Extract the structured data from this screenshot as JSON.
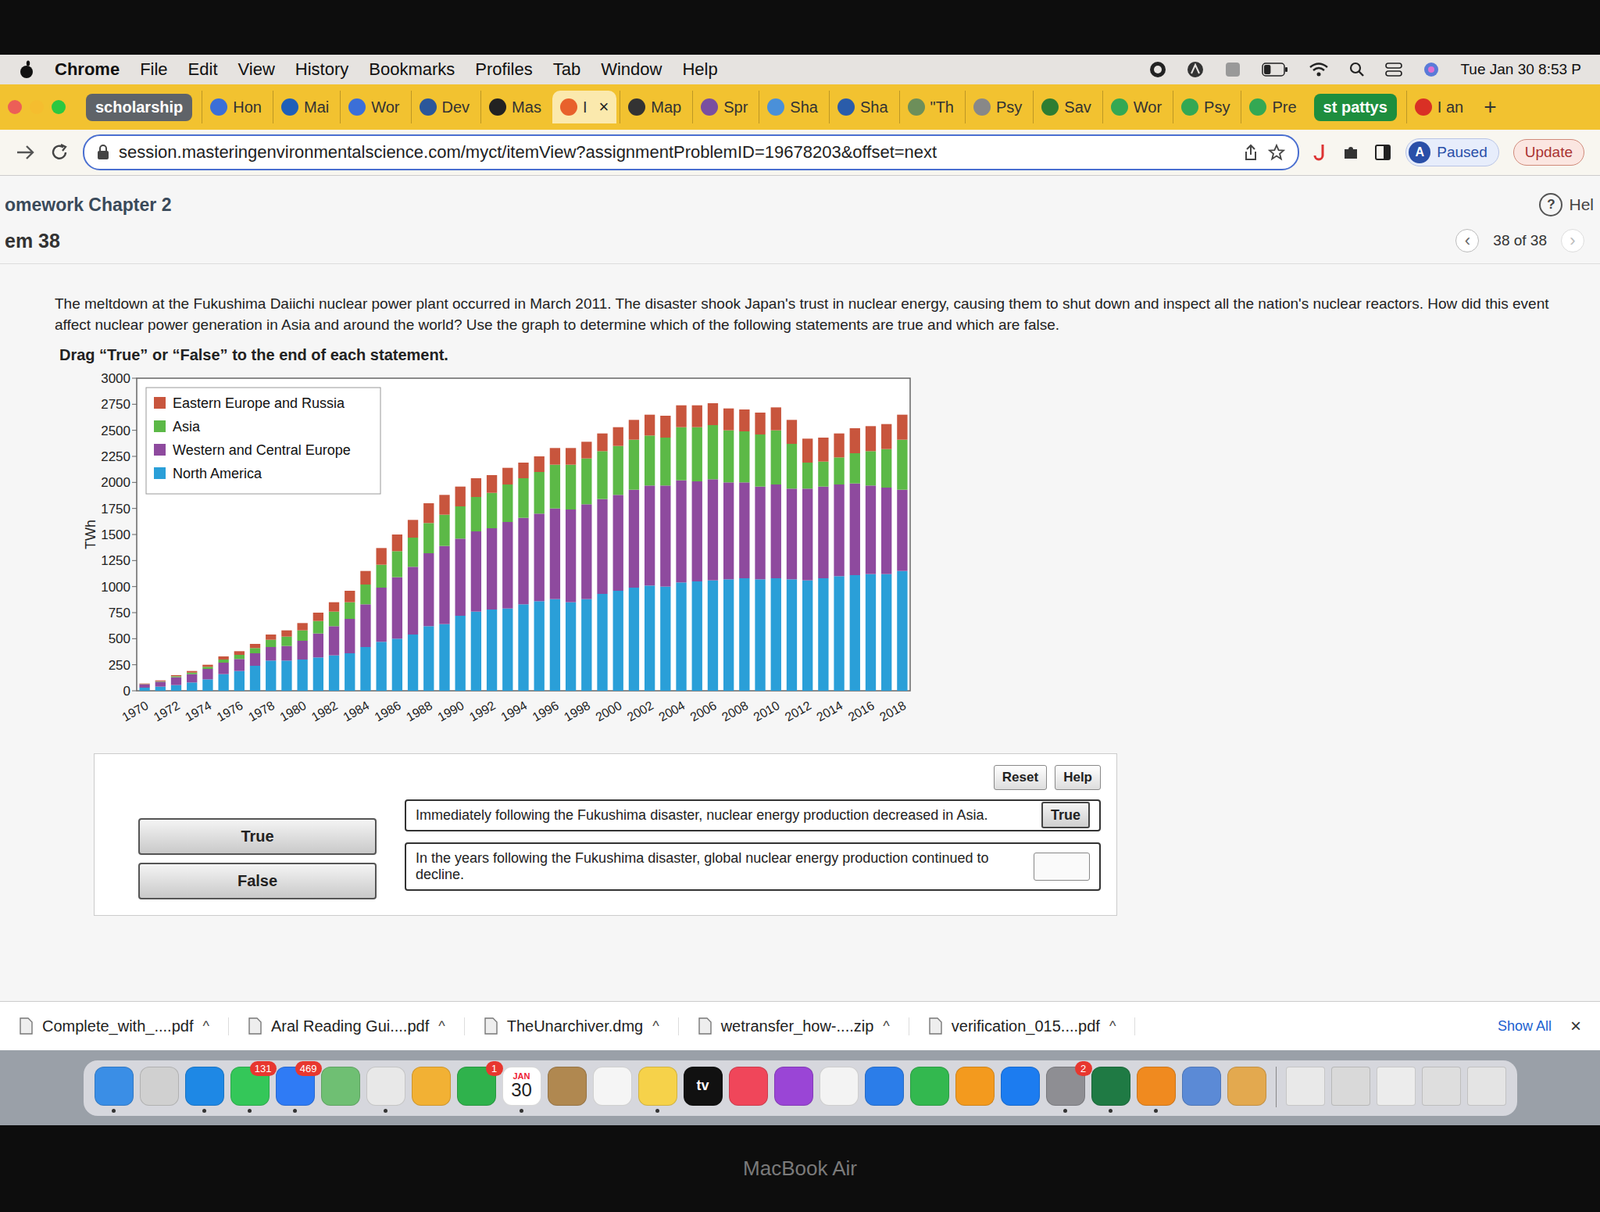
{
  "menubar": {
    "app": "Chrome",
    "items": [
      "File",
      "Edit",
      "View",
      "History",
      "Bookmarks",
      "Profiles",
      "Tab",
      "Window",
      "Help"
    ],
    "battery_level": 0.35,
    "clock": "Tue Jan 30  8:53 P"
  },
  "tabbar": [
    {
      "kind": "group",
      "label": "scholarship",
      "color": "#5f6368"
    },
    {
      "kind": "tab",
      "label": "Hon",
      "selected": false,
      "icon_color": "#3b6fd8"
    },
    {
      "kind": "tab",
      "label": "Mai",
      "selected": false,
      "icon_color": "#1f5fb8"
    },
    {
      "kind": "tab",
      "label": "Wor",
      "selected": false,
      "icon_color": "#3b6fd8"
    },
    {
      "kind": "tab",
      "label": "Dev",
      "selected": false,
      "icon_color": "#2b579a"
    },
    {
      "kind": "tab",
      "label": "Mas",
      "selected": false,
      "icon_color": "#222222"
    },
    {
      "kind": "tab",
      "label": "I",
      "selected": true,
      "icon_color": "#e8612c",
      "close": "×"
    },
    {
      "kind": "tab",
      "label": "Map",
      "selected": false,
      "icon_color": "#333333"
    },
    {
      "kind": "tab",
      "label": "Spr",
      "selected": false,
      "icon_color": "#7a4fa0"
    },
    {
      "kind": "tab",
      "label": "Sha",
      "selected": false,
      "icon_color": "#4a90d9"
    },
    {
      "kind": "tab",
      "label": "Sha",
      "selected": false,
      "icon_color": "#2a5caa"
    },
    {
      "kind": "tab",
      "label": "\"Th",
      "selected": false,
      "icon_color": "#6d8f5a"
    },
    {
      "kind": "tab",
      "label": "Psy",
      "selected": false,
      "icon_color": "#888888"
    },
    {
      "kind": "tab",
      "label": "Sav",
      "selected": false,
      "icon_color": "#2e7d32"
    },
    {
      "kind": "tab",
      "label": "Wor",
      "selected": false,
      "icon_color": "#34a853"
    },
    {
      "kind": "tab",
      "label": "Psy",
      "selected": false,
      "icon_color": "#34a853"
    },
    {
      "kind": "tab",
      "label": "Pre",
      "selected": false,
      "icon_color": "#34a853"
    },
    {
      "kind": "group",
      "label": "st pattys",
      "color": "#1e8e3e"
    },
    {
      "kind": "tab",
      "label": "I an",
      "selected": false,
      "icon_color": "#d93025"
    }
  ],
  "new_tab": "+",
  "address": {
    "url": "session.masteringenvironmentalscience.com/myct/itemView?assignmentProblemID=19678203&offset=next",
    "profile_initial": "A",
    "profile_status": "Paused",
    "update": "Update"
  },
  "page": {
    "assignment": "omework Chapter 2",
    "help_icon": "?",
    "help": "Hel",
    "item": "em 38",
    "prev": "‹",
    "pager": "38 of 38",
    "next": "›",
    "question": "The meltdown at the Fukushima Daiichi nuclear power plant occurred in March 2011. The disaster shook Japan's trust in nuclear energy, causing them to shut down and inspect all the nation's nuclear reactors. How did this event affect nuclear power generation in Asia and around the world? Use the graph to determine which of the following statements are true and which are false.",
    "instruction": "Drag “True” or “False” to the end of each statement."
  },
  "chart": {
    "y_label": "TWh",
    "y_ticks": [
      "0",
      "250",
      "500",
      "750",
      "1000",
      "1250",
      "1500",
      "1750",
      "2000",
      "2250",
      "2500",
      "2750",
      "3000"
    ],
    "x_ticks": [
      "1970",
      "1972",
      "1974",
      "1976",
      "1978",
      "1980",
      "1982",
      "1984",
      "1986",
      "1988",
      "1990",
      "1992",
      "1994",
      "1996",
      "1998",
      "2000",
      "2002",
      "2004",
      "2006",
      "2008",
      "2010",
      "2012",
      "2014",
      "2016",
      "2018"
    ],
    "series": [
      {
        "name": "Eastern Europe and Russia",
        "color": "#c8553d",
        "values": [
          5,
          8,
          10,
          15,
          20,
          30,
          35,
          40,
          50,
          60,
          70,
          80,
          90,
          110,
          130,
          160,
          160,
          170,
          190,
          190,
          190,
          180,
          170,
          160,
          150,
          150,
          160,
          160,
          160,
          170,
          180,
          190,
          200,
          210,
          210,
          210,
          210,
          210,
          210,
          210,
          220,
          230,
          230,
          230,
          230,
          240,
          240,
          240,
          240
        ]
      },
      {
        "name": "Asia",
        "color": "#5cb947",
        "values": [
          2,
          5,
          10,
          15,
          20,
          30,
          40,
          50,
          70,
          90,
          100,
          120,
          140,
          160,
          190,
          220,
          250,
          280,
          290,
          300,
          310,
          330,
          340,
          360,
          380,
          400,
          420,
          430,
          440,
          460,
          470,
          480,
          480,
          460,
          510,
          520,
          520,
          500,
          490,
          500,
          520,
          430,
          250,
          240,
          260,
          290,
          330,
          370,
          480
        ]
      },
      {
        "name": "Western and Central Europe",
        "color": "#8e4a9e",
        "values": [
          33,
          47,
          75,
          80,
          100,
          110,
          115,
          120,
          130,
          140,
          180,
          230,
          280,
          330,
          410,
          520,
          590,
          650,
          700,
          750,
          740,
          770,
          780,
          830,
          830,
          840,
          870,
          890,
          910,
          910,
          920,
          940,
          960,
          970,
          980,
          960,
          970,
          930,
          920,
          890,
          900,
          870,
          880,
          880,
          880,
          880,
          850,
          830,
          780
        ]
      },
      {
        "name": "North America",
        "color": "#2a9fd8",
        "values": [
          30,
          40,
          55,
          80,
          110,
          160,
          190,
          240,
          290,
          290,
          300,
          320,
          340,
          360,
          420,
          470,
          500,
          540,
          620,
          640,
          720,
          760,
          780,
          790,
          830,
          860,
          880,
          850,
          880,
          930,
          960,
          990,
          1010,
          1000,
          1040,
          1050,
          1060,
          1070,
          1080,
          1070,
          1080,
          1070,
          1060,
          1080,
          1100,
          1110,
          1120,
          1120,
          1150
        ]
      }
    ]
  },
  "answer_buttons": [
    "Reset",
    "Help"
  ],
  "tokens": [
    "True",
    "False"
  ],
  "statements": [
    {
      "text": "Immediately following the Fukushima disaster, nuclear energy production decreased in Asia.",
      "filled": true,
      "answer": "True"
    },
    {
      "text": "In the years following the Fukushima disaster, global nuclear energy production continued to decline.",
      "filled": false
    }
  ],
  "downloads": {
    "items": [
      {
        "name": "Complete_with_....pdf",
        "chevron": "^"
      },
      {
        "name": "Aral Reading Gui....pdf",
        "chevron": "^"
      },
      {
        "name": "TheUnarchiver.dmg",
        "chevron": "^"
      },
      {
        "name": "wetransfer_how-....zip",
        "chevron": "^"
      },
      {
        "name": "verification_015....pdf",
        "chevron": "^"
      }
    ],
    "show_all": "Show All",
    "close": "×"
  },
  "dock": {
    "apps": [
      {
        "kind": "plain",
        "color": "#3a8ee6",
        "running": true
      },
      {
        "kind": "plain",
        "color": "#d0d0d0",
        "running": false
      },
      {
        "kind": "plain",
        "color": "#1e88e5",
        "running": true
      },
      {
        "kind": "plain",
        "color": "#34c759",
        "running": true,
        "badge": "131"
      },
      {
        "kind": "plain",
        "color": "#2f7bf5",
        "running": true,
        "badge": "469"
      },
      {
        "kind": "plain",
        "color": "#6fbf73",
        "running": false
      },
      {
        "kind": "plain",
        "color": "#e8e8e8",
        "running": true
      },
      {
        "kind": "plain",
        "color": "#f2b134",
        "running": false
      },
      {
        "kind": "plain",
        "color": "#2fb24c",
        "running": false,
        "badge": "1"
      },
      {
        "kind": "calendar",
        "color": "#ffffff",
        "running": true,
        "month": "JAN",
        "day": "30"
      },
      {
        "kind": "plain",
        "color": "#b08850",
        "running": false
      },
      {
        "kind": "plain",
        "color": "#f5f5f5",
        "running": false
      },
      {
        "kind": "plain",
        "color": "#f6d24a",
        "running": true
      },
      {
        "kind": "text",
        "color": "#111111",
        "running": false,
        "text": "tv"
      },
      {
        "kind": "plain",
        "color": "#f0465a",
        "running": false
      },
      {
        "kind": "plain",
        "color": "#9a45d6",
        "running": false
      },
      {
        "kind": "plain",
        "color": "#f3f3f3",
        "running": false
      },
      {
        "kind": "plain",
        "color": "#2b7de9",
        "running": false
      },
      {
        "kind": "plain",
        "color": "#33b84f",
        "running": false
      },
      {
        "kind": "plain",
        "color": "#f39a1e",
        "running": false
      },
      {
        "kind": "plain",
        "color": "#1c7cf0",
        "running": false
      },
      {
        "kind": "plain",
        "color": "#8e8e93",
        "running": true,
        "badge": "2"
      },
      {
        "kind": "plain",
        "color": "#1f7a44",
        "running": true
      },
      {
        "kind": "plain",
        "color": "#f08a1f",
        "running": true
      },
      {
        "kind": "plain",
        "color": "#5b8ad6",
        "running": false
      },
      {
        "kind": "plain",
        "color": "#e3a94f",
        "running": false
      }
    ],
    "windows": [
      {
        "color": "#e9e9e9"
      },
      {
        "color": "#d9d9d9"
      },
      {
        "color": "#ececec"
      },
      {
        "color": "#dedede"
      },
      {
        "color": "#e4e4e4"
      }
    ]
  },
  "bezel": "MacBook Air"
}
